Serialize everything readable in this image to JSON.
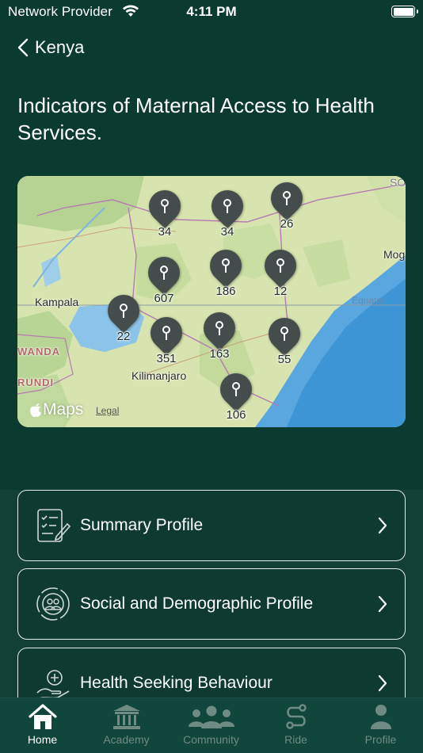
{
  "status_bar": {
    "carrier": "Network Provider",
    "time": "4:11 PM"
  },
  "nav": {
    "back_label": "Kenya"
  },
  "page": {
    "title": "Indicators of Maternal Access to Health Services."
  },
  "map": {
    "labels": {
      "kampala": "Kampala",
      "kilimanjaro": "Kilimanjaro",
      "equator": "Equator",
      "rwanda": "WANDA",
      "burundi": "RUNDI",
      "mog": "Mog",
      "so": "SO"
    },
    "logo": "Maps",
    "legal": "Legal",
    "pins": [
      {
        "count": "34"
      },
      {
        "count": "34"
      },
      {
        "count": "26"
      },
      {
        "count": "607"
      },
      {
        "count": "186"
      },
      {
        "count": "12"
      },
      {
        "count": "22"
      },
      {
        "count": "351"
      },
      {
        "count": "163"
      },
      {
        "count": "55"
      },
      {
        "count": "106"
      }
    ]
  },
  "list": {
    "items": [
      {
        "label": "Summary Profile",
        "icon": "document-checklist-icon"
      },
      {
        "label": "Social and Demographic Profile",
        "icon": "demographics-icon"
      },
      {
        "label": "Health Seeking Behaviour",
        "icon": "hand-health-icon"
      }
    ]
  },
  "tabs": [
    {
      "label": "Home",
      "icon": "home-icon",
      "active": true
    },
    {
      "label": "Academy",
      "icon": "academy-icon",
      "active": false
    },
    {
      "label": "Community",
      "icon": "community-icon",
      "active": false
    },
    {
      "label": "Ride",
      "icon": "route-icon",
      "active": false
    },
    {
      "label": "Profile",
      "icon": "person-icon",
      "active": false
    }
  ],
  "colors": {
    "background": "#0b3a31",
    "pin": "#454d4c",
    "tab_active": "#ffffff",
    "tab_inactive": "#6f8b84"
  }
}
